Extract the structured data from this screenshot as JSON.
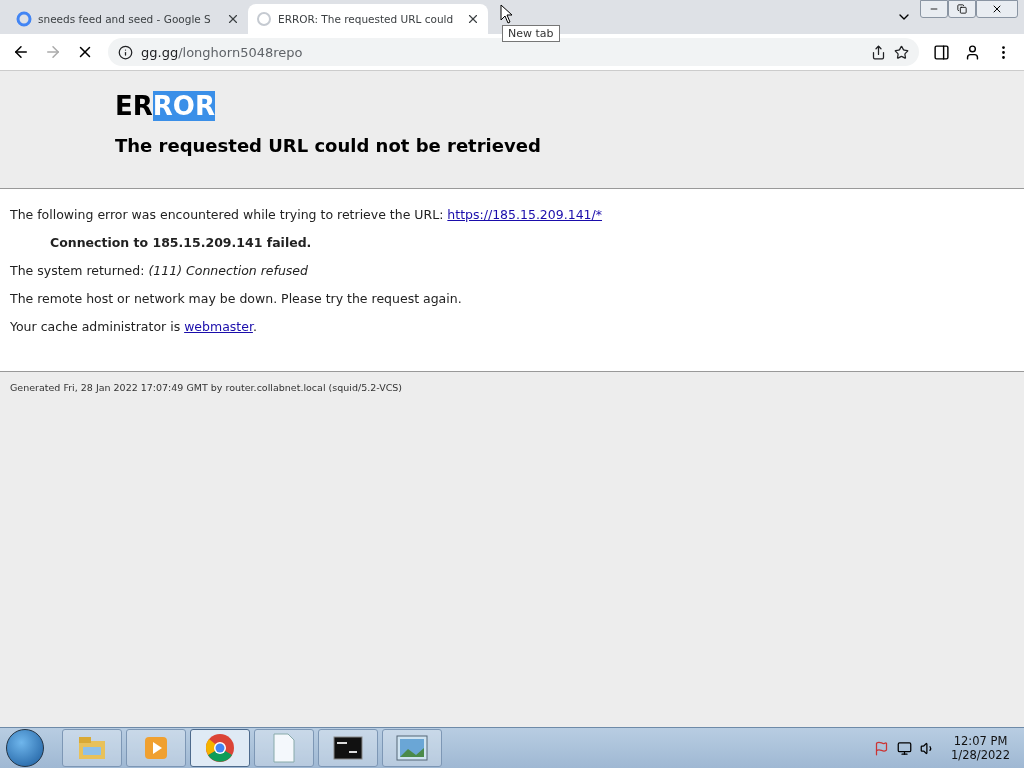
{
  "tabs": [
    {
      "title": "sneeds feed and seed - Google S",
      "selected": false,
      "loading": false
    },
    {
      "title": "ERROR: The requested URL could",
      "selected": true,
      "loading": true
    }
  ],
  "tooltip": "New tab",
  "address_bar": {
    "url_host": "gg.gg",
    "url_path": "/longhorn5048repo"
  },
  "page": {
    "heading_plain": "ER",
    "heading_selected": "ROR",
    "subheading": "The requested URL could not be retrieved",
    "intro": "The following error was encountered while trying to retrieve the URL: ",
    "intro_link": "https://185.15.209.141/*",
    "failure": "Connection to 185.15.209.141 failed.",
    "system_returned": "The system returned: *(111) Connection refused*",
    "advice": "The remote host or network may be down. Please try the request again.",
    "admin": "Your cache administrator is ",
    "admin_link": "webmaster",
    "admin_end": ".",
    "footer": "Generated Fri, 28 Jan 2022 17:07:49 GMT by router.collabnet.local (squid/5.2-VCS)"
  },
  "taskbar": {
    "items": [
      {
        "kind": "explorer",
        "selected": false
      },
      {
        "kind": "media",
        "selected": false
      },
      {
        "kind": "chrome",
        "selected": true
      },
      {
        "kind": "notepad",
        "selected": false
      },
      {
        "kind": "cmd",
        "selected": false
      },
      {
        "kind": "photo",
        "selected": false
      }
    ],
    "time": "12:07 PM",
    "date": "1/28/2022"
  }
}
